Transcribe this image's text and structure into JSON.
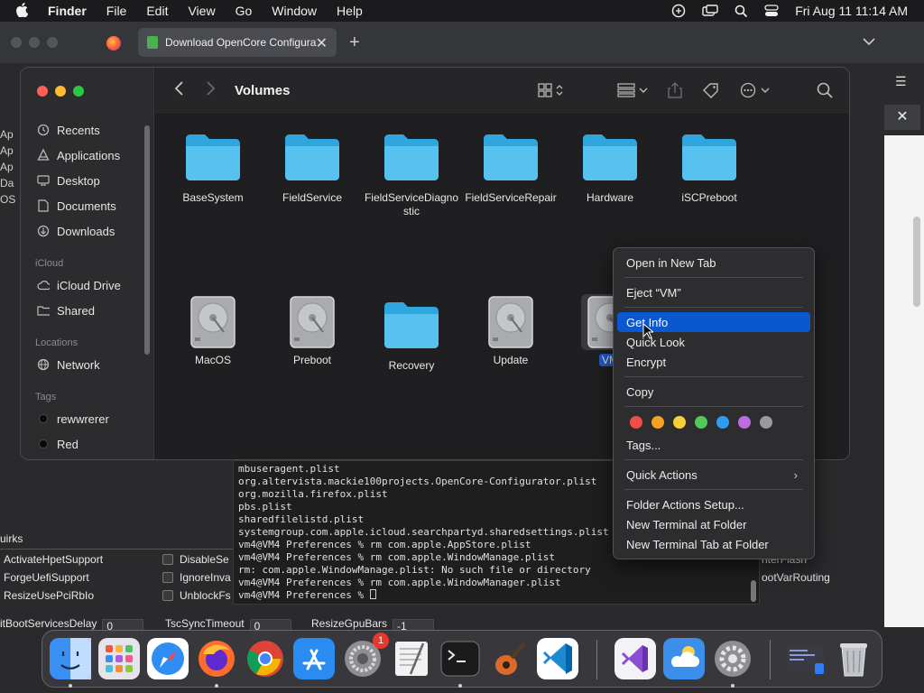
{
  "menubar": {
    "app": "Finder",
    "items": [
      "File",
      "Edit",
      "View",
      "Go",
      "Window",
      "Help"
    ],
    "datetime": "Fri Aug 11  11:14 AM"
  },
  "browser": {
    "tab_title": "Download OpenCore Configurator",
    "tab_close": "✕",
    "new_tab": "+"
  },
  "right_panel": {
    "close": "✕"
  },
  "left_cut": [
    "Ap",
    "Ap",
    "Ap",
    "Da",
    "OS"
  ],
  "finder": {
    "title": "Volumes",
    "sidebar": {
      "favorites": [
        {
          "label": "Recents",
          "icon": "clock-icon"
        },
        {
          "label": "Applications",
          "icon": "applications-icon"
        },
        {
          "label": "Desktop",
          "icon": "desktop-icon"
        },
        {
          "label": "Documents",
          "icon": "document-icon"
        },
        {
          "label": "Downloads",
          "icon": "download-icon"
        }
      ],
      "icloud_header": "iCloud",
      "icloud": [
        {
          "label": "iCloud Drive",
          "icon": "cloud-icon"
        },
        {
          "label": "Shared",
          "icon": "shared-folder-icon"
        }
      ],
      "locations_header": "Locations",
      "locations": [
        {
          "label": "Network",
          "icon": "globe-icon"
        }
      ],
      "tags_header": "Tags",
      "tags": [
        {
          "label": "rewwrerer"
        },
        {
          "label": "Red"
        }
      ]
    },
    "items": [
      {
        "label": "BaseSystem",
        "type": "folder"
      },
      {
        "label": "FieldService",
        "type": "folder"
      },
      {
        "label": "FieldServiceDiagnostic",
        "type": "folder"
      },
      {
        "label": "FieldServiceRepair",
        "type": "folder"
      },
      {
        "label": "Hardware",
        "type": "folder"
      },
      {
        "label": "iSCPreboot",
        "type": "folder"
      },
      {
        "label": "MacOS",
        "type": "disk"
      },
      {
        "label": "Preboot",
        "type": "disk"
      },
      {
        "label": "Recovery",
        "type": "folder"
      },
      {
        "label": "Update",
        "type": "disk"
      },
      {
        "label": "VM",
        "type": "disk",
        "selected": true
      }
    ]
  },
  "context_menu": {
    "open_new_tab": "Open in New Tab",
    "eject": "Eject “VM”",
    "get_info": "Get Info",
    "quick_look": "Quick Look",
    "encrypt": "Encrypt",
    "copy": "Copy",
    "tag_colors": [
      "#ee4e45",
      "#f5a223",
      "#f7d038",
      "#53c75a",
      "#2f9bf2",
      "#bc6ce0",
      "#9a9a9e"
    ],
    "tags": "Tags...",
    "quick_actions": "Quick Actions",
    "folder_actions": "Folder Actions Setup...",
    "new_terminal": "New Terminal at Folder",
    "new_terminal_tab": "New Terminal Tab at Folder"
  },
  "terminal": {
    "lines": [
      "mbuseragent.plist",
      "org.altervista.mackie100projects.OpenCore-Configurator.plist",
      "org.mozilla.firefox.plist",
      "pbs.plist",
      "sharedfilelistd.plist",
      "systemgroup.com.apple.icloud.searchpartyd.sharedsettings.plist",
      "vm4@VM4 Preferences % rm com.apple.AppStore.plist",
      "vm4@VM4 Preferences % rm com.apple.WindowManage.plist",
      "rm: com.apple.WindowManage.plist: No such file or directory",
      "vm4@VM4 Preferences % rm com.apple.WindowManager.plist",
      "vm4@VM4 Preferences % "
    ]
  },
  "quirks": {
    "header": "uirks",
    "col1": [
      "ActivateHpetSupport",
      "ForgeUefiSupport",
      "ResizeUsePciRbIo"
    ],
    "col2": [
      "DisableSe",
      "IgnoreInva",
      "UnblockFs"
    ],
    "right": [
      "nterFlash",
      "ootVarRouting"
    ],
    "fields": [
      {
        "label": "itBootServicesDelay",
        "value": "0"
      },
      {
        "label": "TscSyncTimeout",
        "value": "0"
      },
      {
        "label": "ResizeGpuBars",
        "value": "-1"
      }
    ]
  },
  "dock": {
    "apps": [
      {
        "name": "finder-icon",
        "color": "#3a8ff5"
      },
      {
        "name": "launchpad-icon",
        "color": "#d9d9de"
      },
      {
        "name": "safari-icon",
        "color": "#2f8df3"
      },
      {
        "name": "firefox-icon",
        "color": "#ff6b2b"
      },
      {
        "name": "chrome-icon",
        "color": "#ffffff"
      },
      {
        "name": "app-store-icon",
        "color": "#2a8cf0"
      },
      {
        "name": "system-settings-icon",
        "color": "#8e8e93",
        "badge": "1"
      },
      {
        "name": "textedit-icon",
        "color": "#f2f2f2"
      },
      {
        "name": "terminal-icon",
        "color": "#1b1b1b"
      },
      {
        "name": "garageband-icon",
        "color": "#2a2a2a"
      },
      {
        "name": "vscode-icon",
        "color": "#ffffff"
      },
      {
        "name": "visual-studio-icon",
        "color": "#f3f3f6"
      },
      {
        "name": "weather-icon",
        "color": "#3b8eea"
      },
      {
        "name": "gear-app-icon",
        "color": "#8e8e93"
      },
      {
        "name": "screen-recording-icon",
        "color": "#3a3a44"
      },
      {
        "name": "trash-icon",
        "color": "#bfc3c8"
      }
    ]
  }
}
